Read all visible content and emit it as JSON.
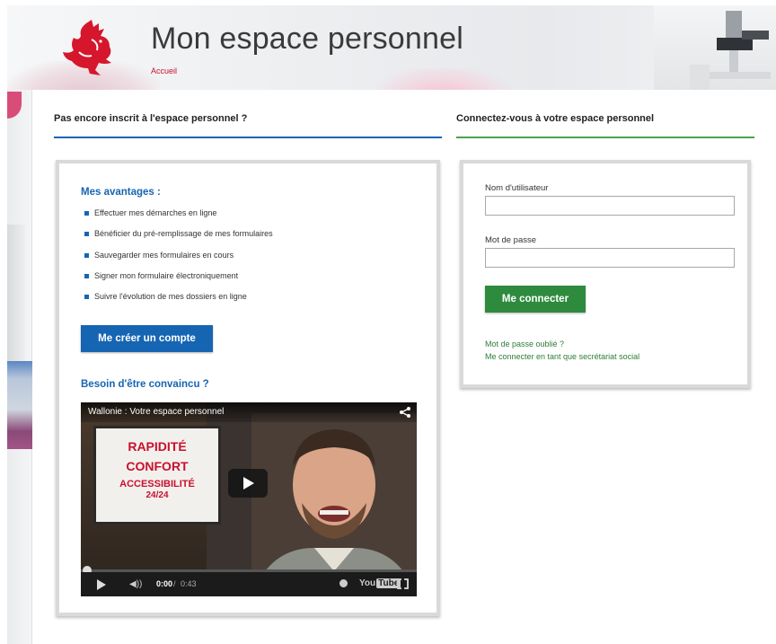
{
  "header": {
    "title": "Mon espace personnel",
    "breadcrumb": "Accueil"
  },
  "colors": {
    "primary_blue": "#1565b3",
    "primary_green": "#2e8b3e",
    "brand_red": "#c8102e"
  },
  "left_section": {
    "title": "Pas encore inscrit à l'espace personnel ?",
    "advantages_heading": "Mes avantages :",
    "advantages": [
      "Effectuer mes démarches en ligne",
      "Bénéficier du pré-remplissage de mes formulaires",
      "Sauvegarder mes formulaires en cours",
      "Signer mon formulaire électroniquement",
      "Suivre l'évolution de mes dossiers en ligne"
    ],
    "create_button": "Me créer un compte",
    "convince_heading": "Besoin d'être convaincu ?",
    "video": {
      "title": "Wallonie : Votre espace personnel",
      "screen_text": [
        "RAPIDITÉ",
        "CONFORT",
        "ACCESSIBILITÉ",
        "24/24"
      ],
      "current_time": "0:00",
      "separator": "/",
      "duration": "0:43",
      "progress": 0,
      "youtube_label": "You",
      "youtube_badge": "Tube"
    }
  },
  "right_section": {
    "title": "Connectez-vous à votre espace personnel",
    "username_label": "Nom d'utilisateur",
    "username_value": "",
    "password_label": "Mot de passe",
    "password_value": "",
    "login_button": "Me connecter",
    "forgot_link": "Mot de passe oublié ?",
    "secretariat_link": "Me connecter en tant que secrétariat social"
  }
}
